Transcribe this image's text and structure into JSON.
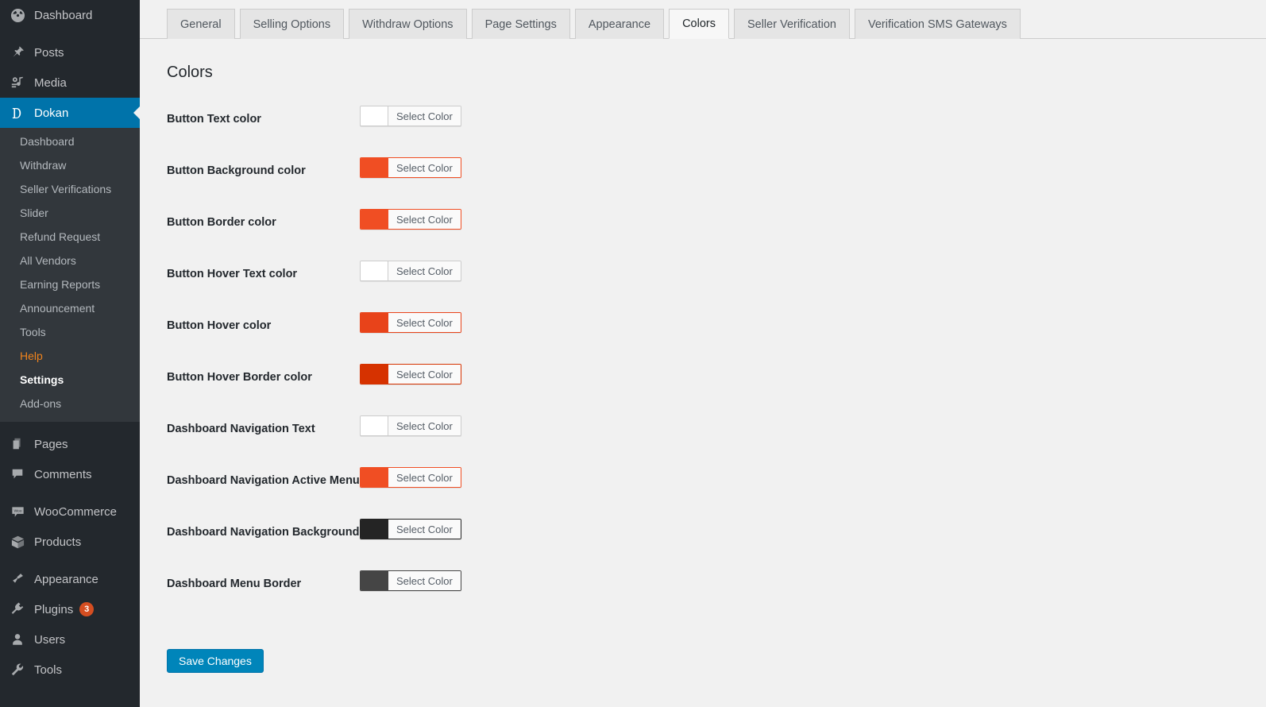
{
  "sidebar": {
    "top_items": [
      {
        "label": "Dashboard",
        "icon": "dashboard-icon",
        "active": false
      },
      {
        "label": "Posts",
        "icon": "pin-icon",
        "active": false
      },
      {
        "label": "Media",
        "icon": "media-icon",
        "active": false
      },
      {
        "label": "Dokan",
        "icon": "dokan-logo-icon",
        "active": true
      }
    ],
    "submenu": [
      {
        "label": "Dashboard",
        "state": "normal"
      },
      {
        "label": "Withdraw",
        "state": "normal"
      },
      {
        "label": "Seller Verifications",
        "state": "normal"
      },
      {
        "label": "Slider",
        "state": "normal"
      },
      {
        "label": "Refund Request",
        "state": "normal"
      },
      {
        "label": "All Vendors",
        "state": "normal"
      },
      {
        "label": "Earning Reports",
        "state": "normal"
      },
      {
        "label": "Announcement",
        "state": "normal"
      },
      {
        "label": "Tools",
        "state": "normal"
      },
      {
        "label": "Help",
        "state": "help"
      },
      {
        "label": "Settings",
        "state": "current"
      },
      {
        "label": "Add-ons",
        "state": "normal"
      }
    ],
    "mid_items": [
      {
        "label": "Pages",
        "icon": "pages-icon"
      },
      {
        "label": "Comments",
        "icon": "comment-icon"
      }
    ],
    "commerce_items": [
      {
        "label": "WooCommerce",
        "icon": "woocommerce-icon"
      },
      {
        "label": "Products",
        "icon": "products-box-icon"
      }
    ],
    "bottom_items": [
      {
        "label": "Appearance",
        "icon": "paintbrush-icon",
        "badge": ""
      },
      {
        "label": "Plugins",
        "icon": "plug-icon",
        "badge": "3"
      },
      {
        "label": "Users",
        "icon": "user-icon",
        "badge": ""
      },
      {
        "label": "Tools",
        "icon": "wrench-icon",
        "badge": ""
      }
    ],
    "colors": {
      "background": "#23282d",
      "submenu_background": "#32373c",
      "active": "#0073aa",
      "help_text": "#f0831c",
      "badge": "#d54e21"
    }
  },
  "tabs": [
    {
      "label": "General",
      "active": false
    },
    {
      "label": "Selling Options",
      "active": false
    },
    {
      "label": "Withdraw Options",
      "active": false
    },
    {
      "label": "Page Settings",
      "active": false
    },
    {
      "label": "Appearance",
      "active": false
    },
    {
      "label": "Colors",
      "active": true
    },
    {
      "label": "Seller Verification",
      "active": false
    },
    {
      "label": "Verification SMS Gateways",
      "active": false
    }
  ],
  "page": {
    "section_title": "Colors",
    "select_color_label": "Select Color",
    "save_label": "Save Changes",
    "save_color": "#0085ba"
  },
  "color_fields": [
    {
      "label": "Button Text color",
      "value": "#ffffff"
    },
    {
      "label": "Button Background color",
      "value": "#f04e23"
    },
    {
      "label": "Button Border color",
      "value": "#f04e23"
    },
    {
      "label": "Button Hover Text color",
      "value": "#ffffff"
    },
    {
      "label": "Button Hover color",
      "value": "#e8431a"
    },
    {
      "label": "Button Hover Border color",
      "value": "#d63200"
    },
    {
      "label": "Dashboard Navigation Text",
      "value": "#ffffff"
    },
    {
      "label": "Dashboard Navigation Active Menu",
      "value": "#f04e23"
    },
    {
      "label": "Dashboard Navigation Background",
      "value": "#242424"
    },
    {
      "label": "Dashboard Menu Border",
      "value": "#454545"
    }
  ]
}
